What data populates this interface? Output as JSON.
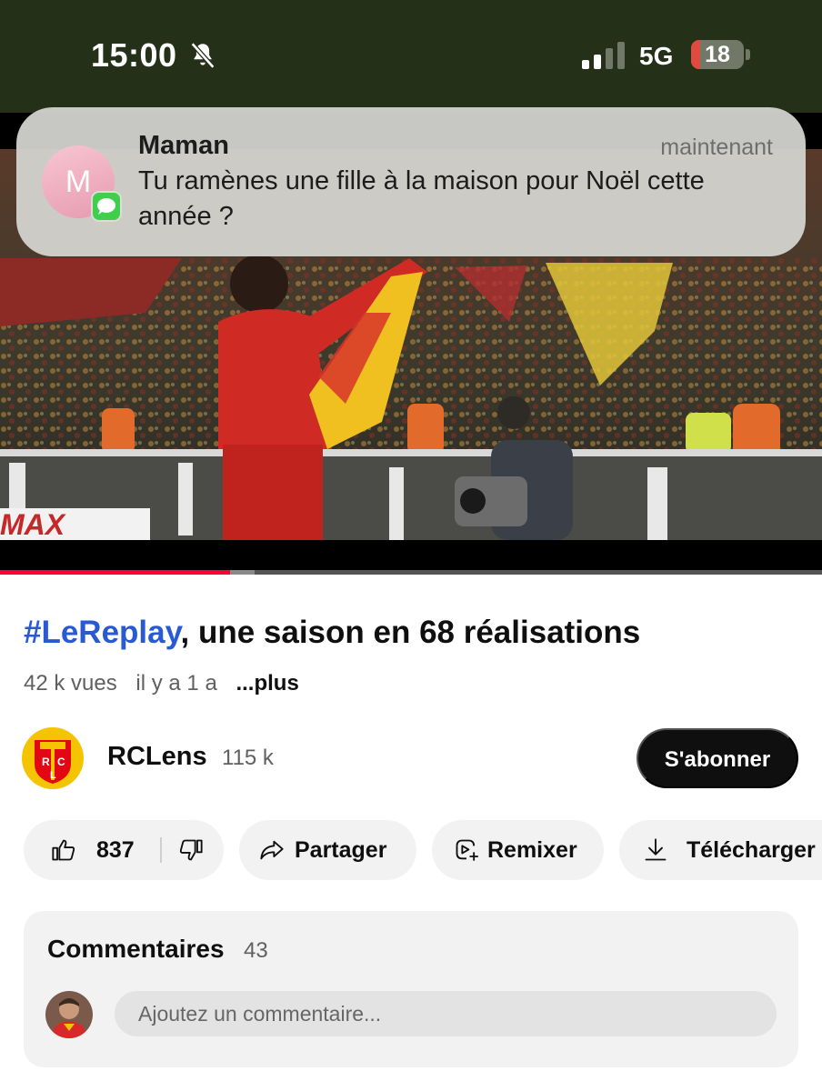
{
  "status_bar": {
    "time": "15:00",
    "network": "5G",
    "battery_level": "18",
    "battery_fraction": 0.18,
    "icons": [
      "bell-slash-icon",
      "signal-icon",
      "battery-icon"
    ]
  },
  "notification": {
    "avatar_letter": "M",
    "sender": "Maman",
    "time": "maintenant",
    "message": "Tu ramènes une fille à la maison pour Noël cette année ?",
    "app_icon": "messages-icon"
  },
  "video": {
    "scene": "stadium-celebration-thumbnail",
    "progress_played": 0.28,
    "progress_buffered": 0.31,
    "accent_color": "#ff0033"
  },
  "title": {
    "hashtag": "#LeReplay",
    "text": ", une saison en 68 réalisations"
  },
  "meta": {
    "views": "42 k vues",
    "age": "il y a 1 a",
    "more": "...plus"
  },
  "channel": {
    "name": "RCLens",
    "subscribers": "115 k",
    "logo_letters": "RCL",
    "subscribe_label": "S'abonner"
  },
  "actions": {
    "likes": "837",
    "share": "Partager",
    "remix": "Remixer",
    "download": "Télécharger"
  },
  "comments": {
    "title": "Commentaires",
    "count": "43",
    "placeholder": "Ajoutez un commentaire..."
  },
  "colors": {
    "hashtag": "#2a5ad3",
    "status_bar_bg": "#253018",
    "club_red": "#e30613",
    "club_yellow": "#f5c400"
  }
}
